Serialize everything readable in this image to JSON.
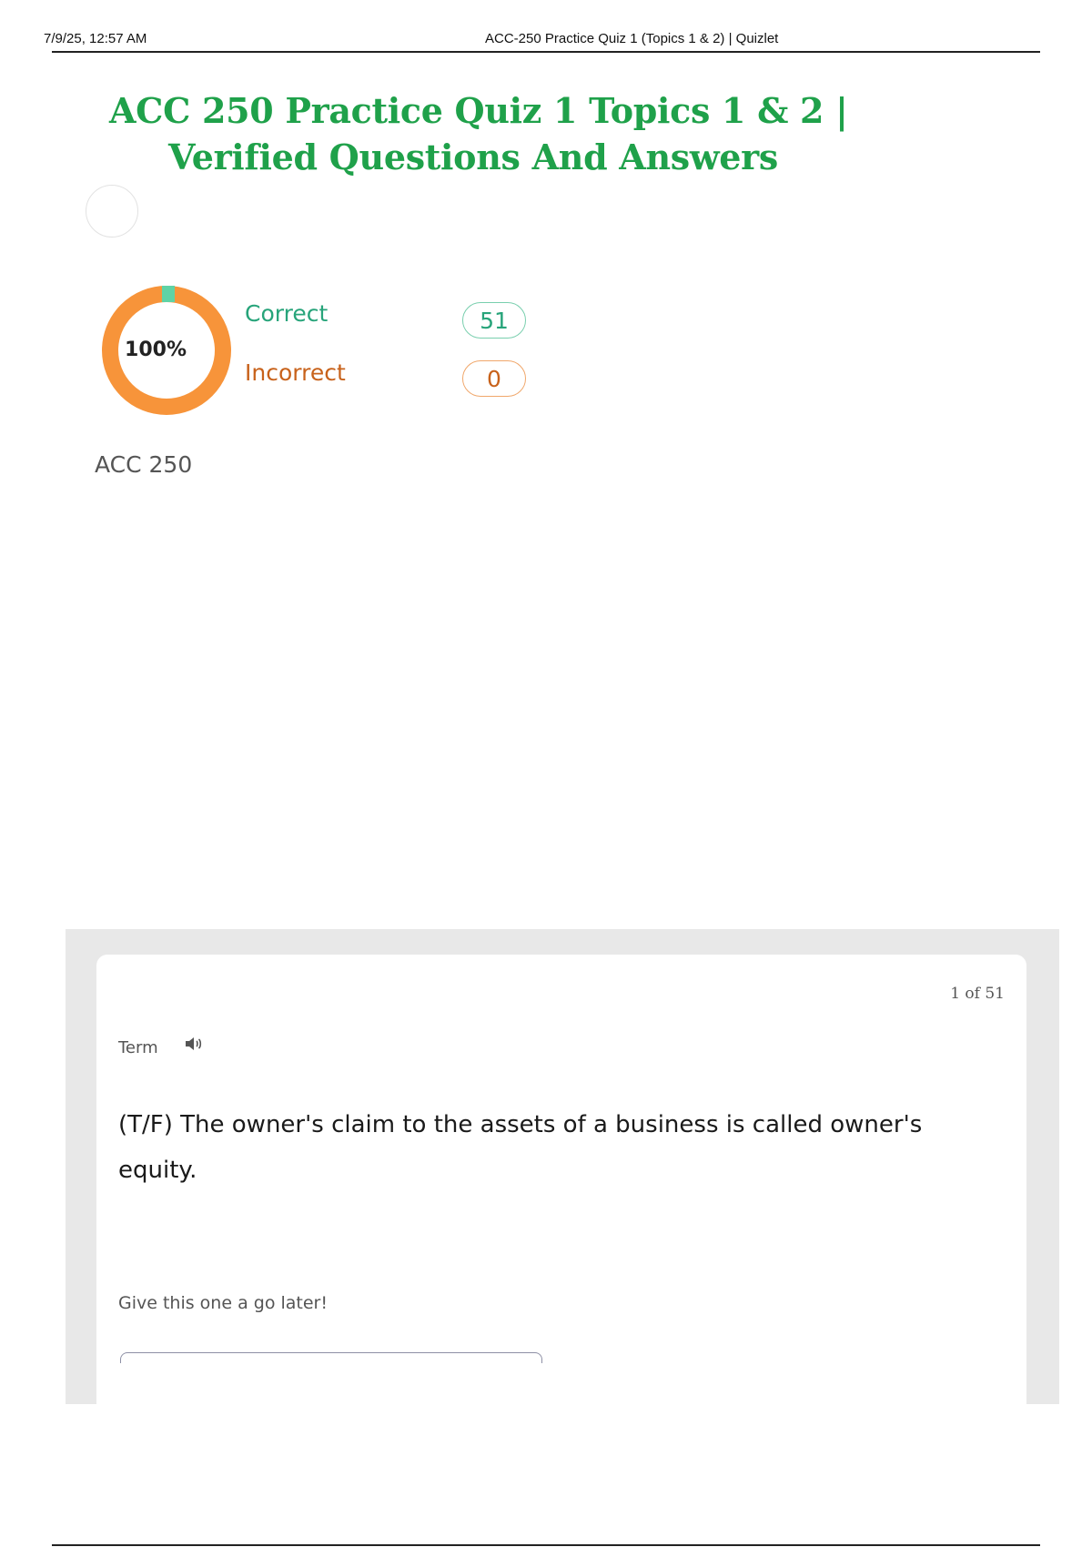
{
  "print_header": {
    "date": "7/9/25, 12:57 AM",
    "title": "ACC-250 Practice Quiz 1 (Topics 1 & 2) | Quizlet"
  },
  "document": {
    "title_line1": "ACC 250 Practice Quiz 1 Topics 1 & 2 |",
    "title_line2": "Verified Questions And Answers"
  },
  "results": {
    "score_percent": "100%",
    "score_fraction": 1.0,
    "correct_label": "Correct",
    "correct_count": "51",
    "incorrect_label": "Incorrect",
    "incorrect_count": "0"
  },
  "course": {
    "label": "ACC 250"
  },
  "card": {
    "counter": "1 of 51",
    "term_label": "Term",
    "question": "(T/F) The owner's claim to the assets of a business is called owner's equity.",
    "hint": "Give this one a go later!"
  },
  "icons": {
    "speaker": "speaker-icon"
  },
  "colors": {
    "title_green": "#1fa14a",
    "correct_green": "#27a47a",
    "incorrect_orange": "#c8621b",
    "ring_orange": "#f7943a",
    "ring_marker": "#5fd3a5"
  }
}
